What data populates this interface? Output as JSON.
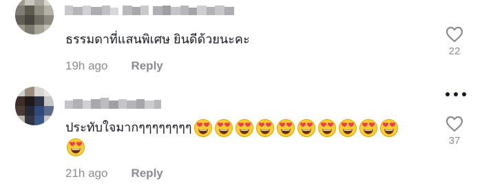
{
  "comments": [
    {
      "text": "ธรรมดาที่แสนพิเศษ ยินดีด้วยนะคะ",
      "time": "19h ago",
      "reply_label": "Reply",
      "likes": "22",
      "emoji_count": 0,
      "avatar_icon": "blurred-avatar"
    },
    {
      "text": "ประทับใจมากๆๆๆๆๆๆๆๆ",
      "time": "21h ago",
      "reply_label": "Reply",
      "likes": "37",
      "emoji_count": 11,
      "emoji_icon": "heart-eyes-emoji",
      "avatar_icon": "blurred-avatar"
    }
  ],
  "icons": {
    "like": "heart-outline-icon",
    "more": "more-options-icon"
  },
  "colors": {
    "meta": "#8a8b91",
    "text": "#161823",
    "emoji_face": "#ffcc33",
    "emoji_heart": "#ef3b4f"
  }
}
